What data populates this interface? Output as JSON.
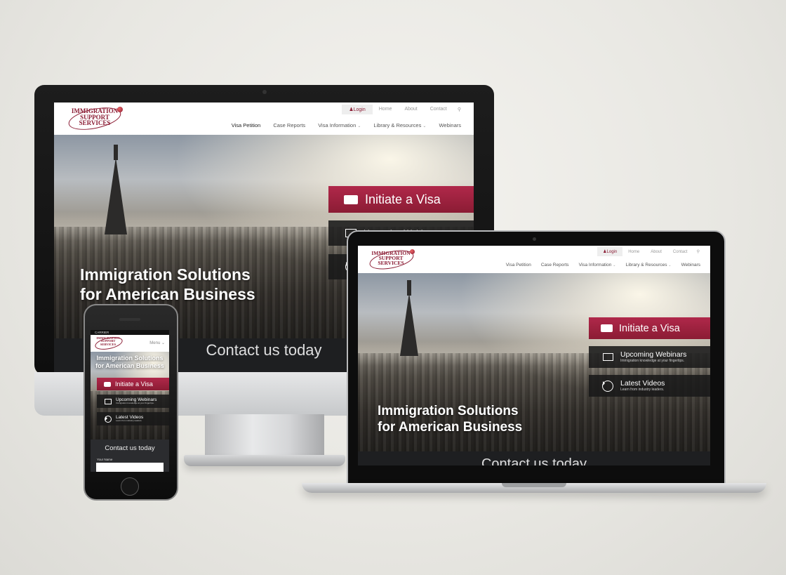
{
  "site": {
    "logo_lines": [
      "Immigration",
      "Support",
      "Services"
    ],
    "topbar": {
      "login": "Login",
      "home": "Home",
      "about": "About",
      "contact": "Contact"
    },
    "menu": {
      "visa_petition": "Visa Petition",
      "case_reports": "Case Reports",
      "visa_information": "Visa Information",
      "library_resources": "Library & Resources",
      "webinars": "Webinars"
    },
    "mobile_menu": "Menu",
    "headline_line1": "Immigration Solutions",
    "headline_line2": "for American Business",
    "cta_visa": "Initiate a Visa",
    "cta_webinars": "Upcoming Webinars",
    "cta_webinars_sub": "Immigration knowledge at your fingertips.",
    "cta_videos": "Latest Videos",
    "cta_videos_sub": "Learn from industry leaders.",
    "contact_heading": "Contact us today",
    "form_label_name": "Your Name",
    "carrier": "CARRIER"
  },
  "colors": {
    "brand": "#8b1c34",
    "dark_band": "#1e1f21"
  },
  "icons": [
    "user-icon",
    "search-icon",
    "chevron-down-icon",
    "id-card-icon",
    "laptop-icon",
    "play-icon"
  ]
}
